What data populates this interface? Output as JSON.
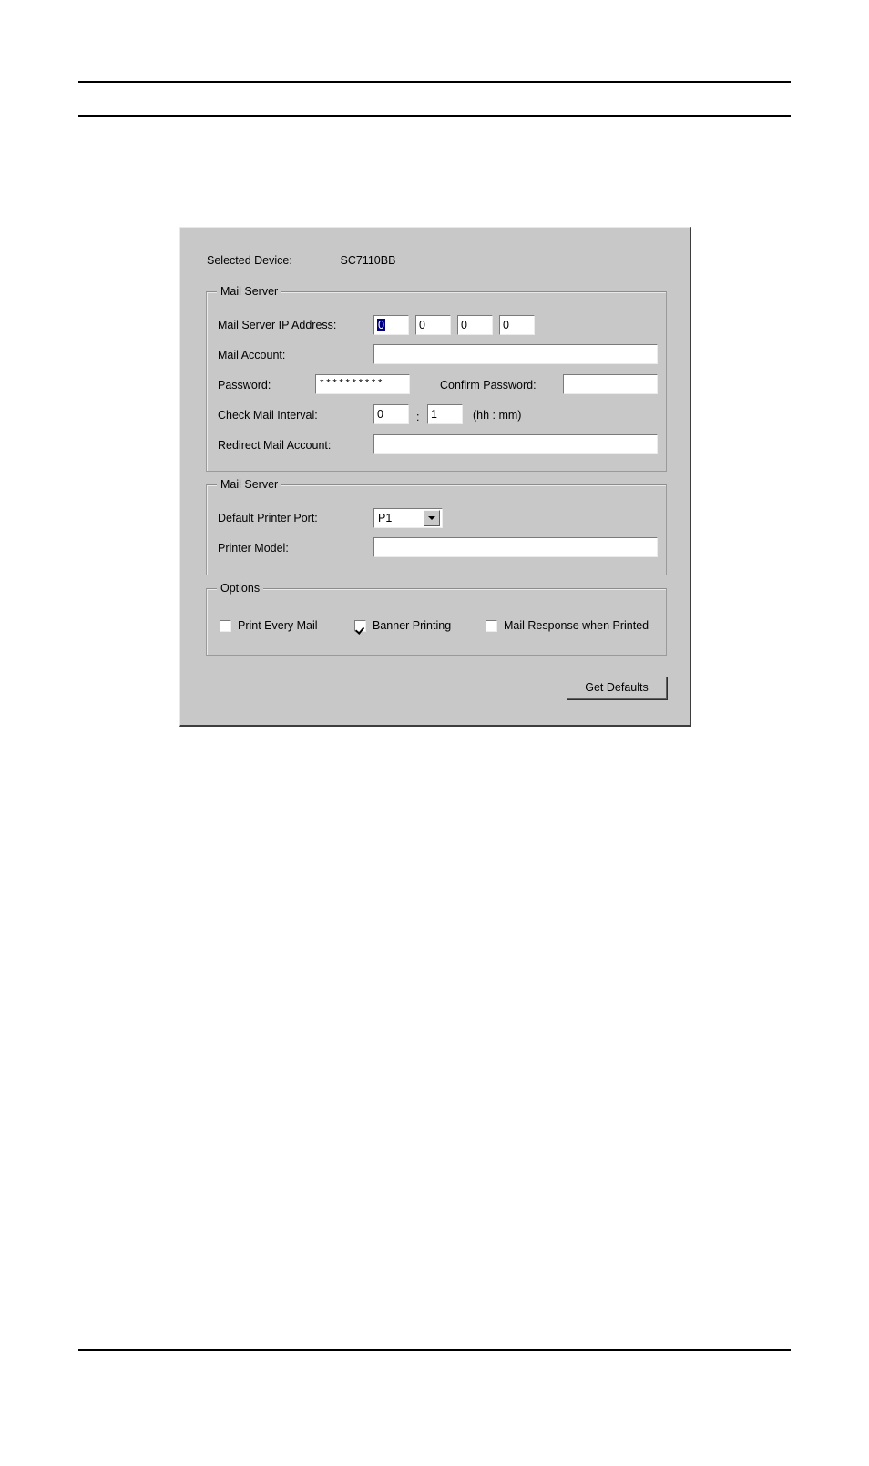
{
  "page": {
    "rules": [
      "top-rule-1",
      "top-rule-2",
      "bottom-rule"
    ]
  },
  "dialog": {
    "device": {
      "label": "Selected Device:",
      "value": "SC7110BB"
    },
    "groups": {
      "mail_server": {
        "legend": "Mail Server",
        "fields": {
          "ip_address": {
            "label": "Mail Server IP Address:",
            "octets": [
              "0",
              "0",
              "0",
              "0"
            ],
            "selected_octet_index": 0,
            "selection_bg": "#000080",
            "selection_fg": "#ffffff"
          },
          "mail_account": {
            "label": "Mail Account:",
            "value": "",
            "placeholder": ""
          },
          "password": {
            "label": "Password:",
            "value": "**********",
            "masked": true
          },
          "confirm_password": {
            "label": "Confirm Password:",
            "value": "",
            "masked": true
          },
          "check_mail_interval": {
            "label": "Check Mail Interval:",
            "hours": "0",
            "separator": ":",
            "minutes": "1",
            "units": "(hh : mm)"
          },
          "redirect_mail_account": {
            "label": "Redirect Mail Account:",
            "value": "",
            "placeholder": ""
          }
        }
      },
      "printer": {
        "legend": "Mail Server",
        "fields": {
          "default_printer_port": {
            "label": "Default Printer Port:",
            "value": "P1",
            "options": [
              "P1"
            ]
          },
          "printer_model": {
            "label": "Printer Model:",
            "value": "",
            "placeholder": ""
          }
        }
      },
      "options": {
        "legend": "Options",
        "checkboxes": [
          {
            "label": "Print Every Mail",
            "checked": false
          },
          {
            "label": "Banner Printing",
            "checked": true
          },
          {
            "label": "Mail Response when Printed",
            "checked": false
          }
        ]
      }
    },
    "buttons": {
      "get_defaults": "Get Defaults"
    },
    "colors": {
      "dialog_face": "#c8c8c8",
      "input_bg": "#ffffff",
      "border_dark": "#3d3d3d",
      "border_light": "#e8e8e8",
      "text": "#000000",
      "selection": "#000080"
    }
  }
}
